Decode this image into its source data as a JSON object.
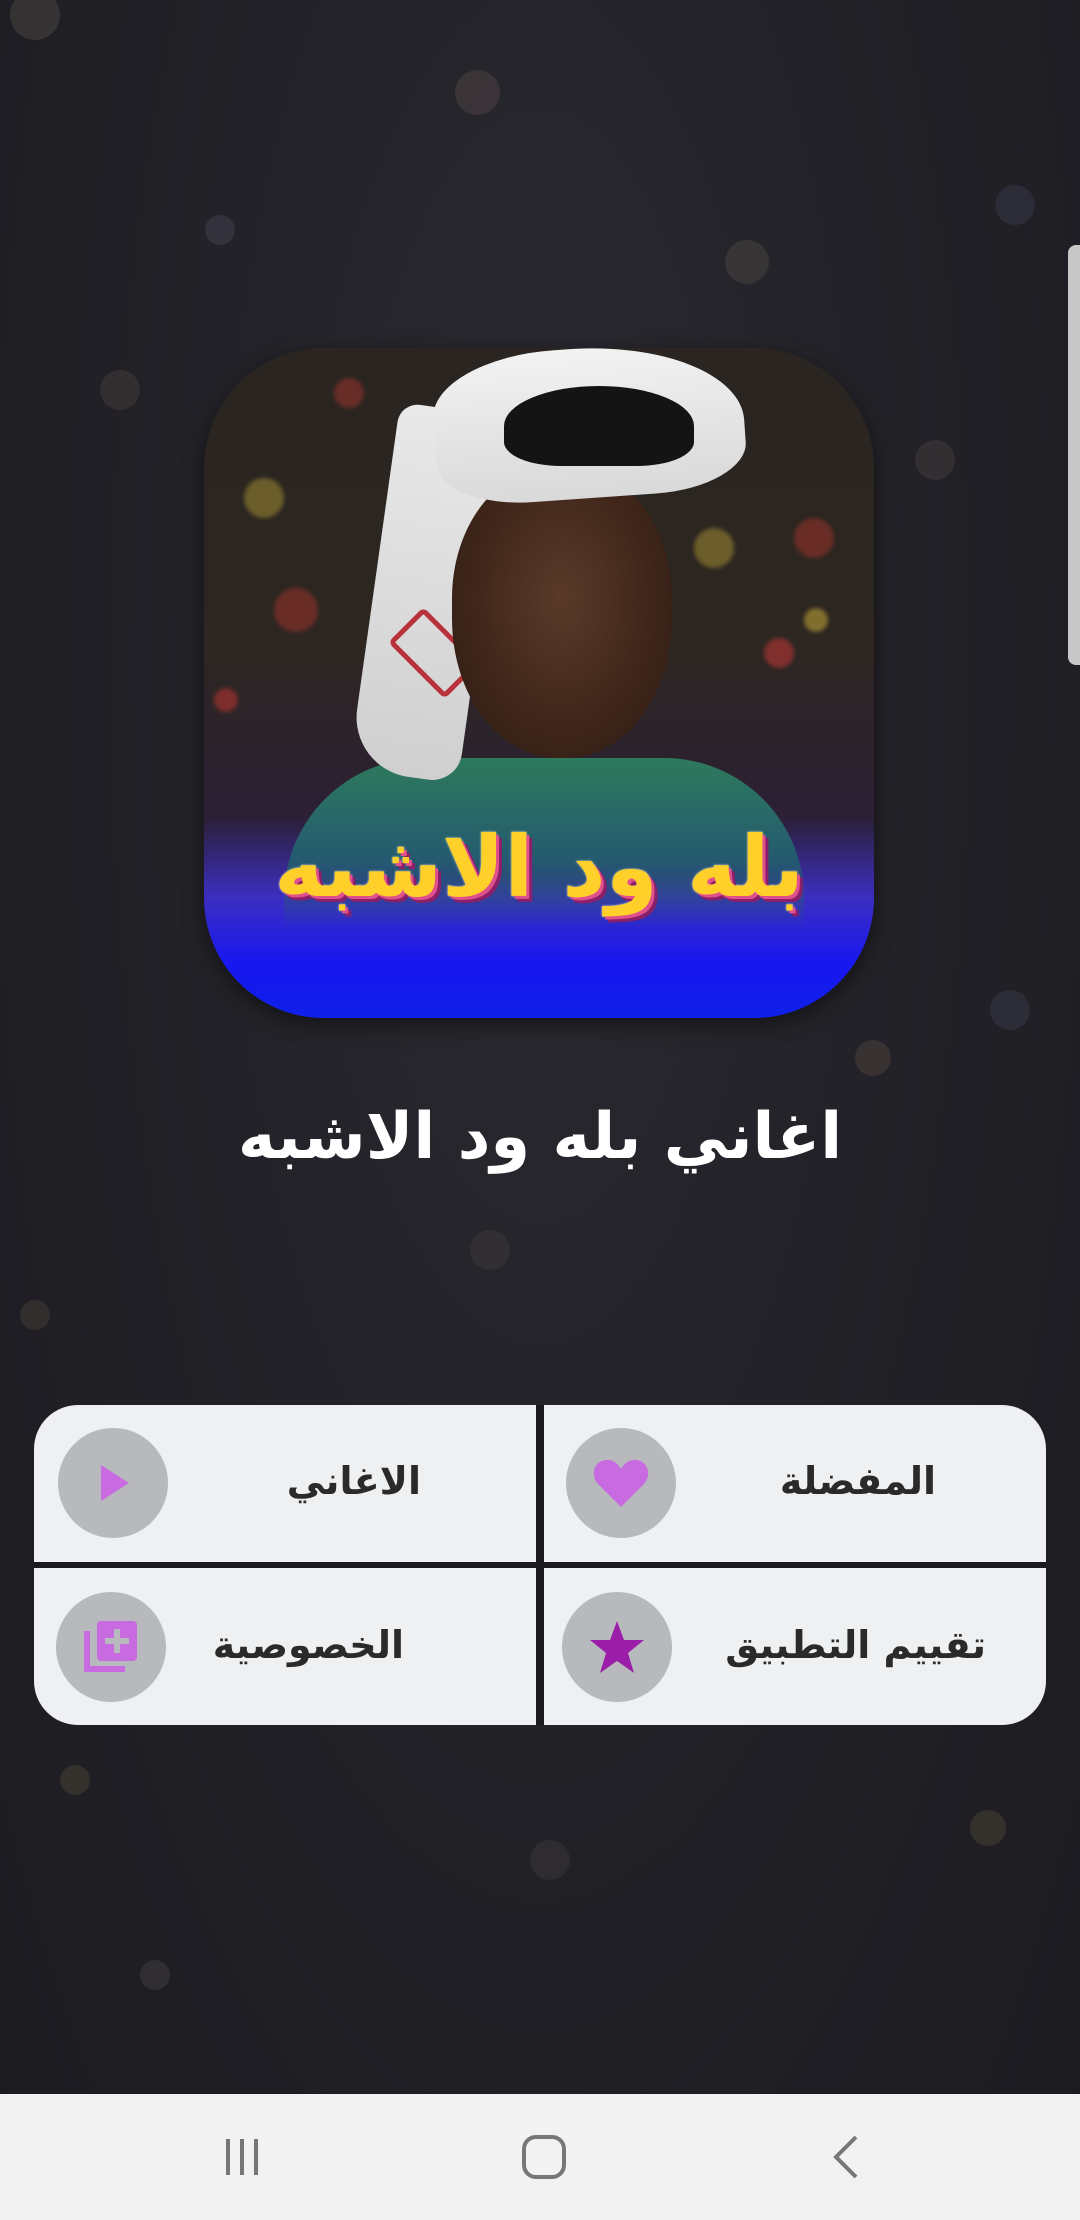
{
  "app": {
    "title": "اغاني بله ود الاشبه",
    "cover_text": "بله ود الاشبه"
  },
  "menu": {
    "favorites_label": "المفضلة",
    "songs_label": "الاغاني",
    "rate_label": "تقييم التطبيق",
    "privacy_label": "الخصوصية"
  },
  "icons": {
    "favorites": "heart-icon",
    "songs": "play-icon",
    "rate": "star-icon",
    "privacy": "add-library-icon"
  },
  "colors": {
    "accent_purple": "#c86ae0",
    "tile_bg": "#eef0f2",
    "icon_circle": "#b7b9bc"
  },
  "navbar": {
    "items": [
      "recent-apps",
      "home",
      "back"
    ]
  }
}
